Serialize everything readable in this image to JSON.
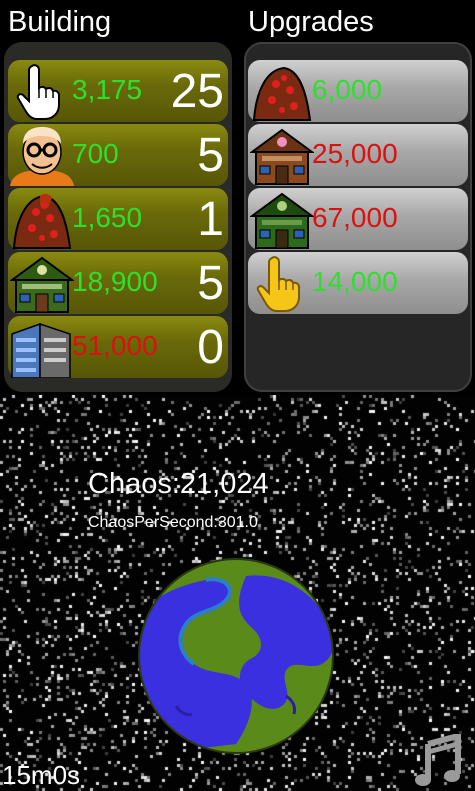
{
  "building": {
    "title": "Building",
    "items": [
      {
        "icon": "hand-pointer-icon",
        "cost": "3,175",
        "count": "25",
        "affordable": true
      },
      {
        "icon": "nerd-man-icon",
        "cost": "700",
        "count": "5",
        "affordable": true
      },
      {
        "icon": "red-volcano-icon",
        "cost": "1,650",
        "count": "1",
        "affordable": true
      },
      {
        "icon": "green-school-icon",
        "cost": "18,900",
        "count": "5",
        "affordable": true
      },
      {
        "icon": "office-building-icon",
        "cost": "51,000",
        "count": "0",
        "affordable": false
      }
    ]
  },
  "upgrades": {
    "title": "Upgrades",
    "items": [
      {
        "icon": "red-volcano-icon",
        "cost": "6,000",
        "affordable": true
      },
      {
        "icon": "brown-school-icon",
        "cost": "25,000",
        "affordable": false
      },
      {
        "icon": "green-school-icon",
        "cost": "67,000",
        "affordable": false
      },
      {
        "icon": "yellow-hand-icon",
        "cost": "14,000",
        "affordable": true
      }
    ]
  },
  "stats": {
    "chaos": "Chaos:21,024",
    "chaos_per_second": "ChaosPerSecond:301.0"
  },
  "timer": "15m0s",
  "colors": {
    "affordable": "#2ee02e",
    "unaffordable": "#dd1010",
    "building_row": "#6a6a0a",
    "upgrade_row": "#a8a8a8"
  }
}
